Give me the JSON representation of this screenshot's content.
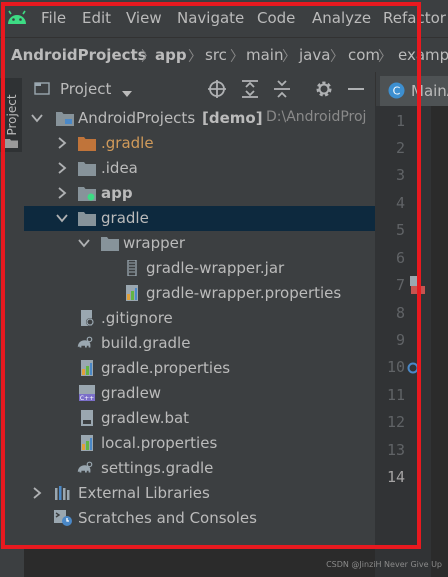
{
  "menu": [
    "File",
    "Edit",
    "View",
    "Navigate",
    "Code",
    "Analyze",
    "Refactor"
  ],
  "breadcrumb": [
    "AndroidProjects",
    "app",
    "src",
    "main",
    "java",
    "com",
    "examp"
  ],
  "tool_window": {
    "side_tab": "Project",
    "view_selector": "Project"
  },
  "editor": {
    "tab_label": "MainA",
    "line_numbers": [
      "1",
      "2",
      "3",
      "4",
      "5",
      "6",
      "7",
      "8",
      "9",
      "10",
      "11",
      "12",
      "13",
      "14"
    ],
    "current_line": "14"
  },
  "tree": [
    {
      "label": "AndroidProjects",
      "extra": "[demo]",
      "hint": "D:\\AndroidProj",
      "icon": "module-folder-icon",
      "expanded": true
    },
    {
      "label": ".gradle",
      "icon": "folder-orange-icon",
      "expanded": false
    },
    {
      "label": ".idea",
      "icon": "folder-icon",
      "expanded": false
    },
    {
      "label": "app",
      "icon": "android-module-folder-icon",
      "expanded": false
    },
    {
      "label": "gradle",
      "icon": "folder-icon",
      "expanded": true,
      "selected": true
    },
    {
      "label": "wrapper",
      "icon": "folder-icon",
      "expanded": true
    },
    {
      "label": "gradle-wrapper.jar",
      "icon": "jar-file-icon"
    },
    {
      "label": "gradle-wrapper.properties",
      "icon": "properties-file-icon"
    },
    {
      "label": ".gitignore",
      "icon": "gitignore-file-icon"
    },
    {
      "label": "build.gradle",
      "icon": "gradle-elephant-icon"
    },
    {
      "label": "gradle.properties",
      "icon": "properties-file-icon"
    },
    {
      "label": "gradlew",
      "icon": "shell-script-icon"
    },
    {
      "label": "gradlew.bat",
      "icon": "bat-file-icon"
    },
    {
      "label": "local.properties",
      "icon": "properties-file-icon"
    },
    {
      "label": "settings.gradle",
      "icon": "gradle-elephant-icon"
    },
    {
      "label": "External Libraries",
      "icon": "libraries-icon",
      "expanded": false
    },
    {
      "label": "Scratches and Consoles",
      "icon": "scratches-icon"
    }
  ],
  "watermark": "CSDN @JinziH Never Give Up",
  "colors": {
    "highlight_frame": "#e8191f",
    "selection": "#0d293e",
    "panel": "#3c3f41",
    "folder": "#87939a",
    "orange_folder": "#c0743a"
  }
}
